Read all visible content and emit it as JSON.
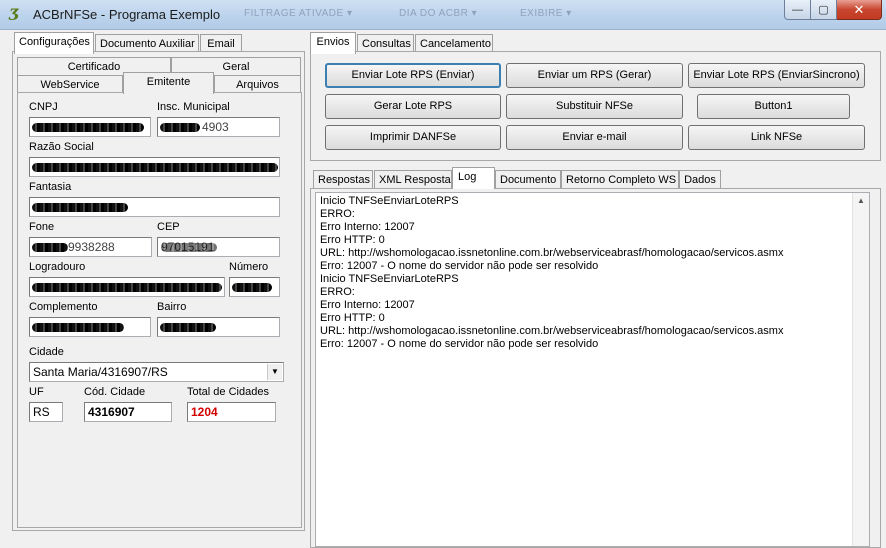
{
  "window": {
    "title": "ACBrNFSe - Programa Exemplo",
    "faded_title_bits": [
      "FILTRAGE ATIVADE ▾",
      "DIA DO ACBR ▾",
      "EXIBIRE ▾"
    ],
    "min_symbol": "—",
    "max_symbol": "▢",
    "close_symbol": "✕"
  },
  "left_tabs": [
    "Configurações",
    "Documento Auxiliar",
    "Email"
  ],
  "config_tabs_row1": [
    "Certificado",
    "Geral"
  ],
  "config_tabs_row2": [
    "WebService",
    "Emitente",
    "Arquivos"
  ],
  "emitente": {
    "cnpj_label": "CNPJ",
    "insc_label": "Insc. Municipal",
    "insc_value_partial": "4903",
    "razao_label": "Razão Social",
    "fantasia_label": "Fantasia",
    "fone_label": "Fone",
    "cep_label": "CEP",
    "fone_value_partial": "9938288",
    "cep_value_partial": "97015191",
    "logradouro_label": "Logradouro",
    "numero_label": "Número",
    "complemento_label": "Complemento",
    "bairro_label": "Bairro",
    "cidade_label": "Cidade",
    "cidade_value": "Santa Maria/4316907/RS",
    "uf_label": "UF",
    "uf_value": "RS",
    "cod_cidade_label": "Cód. Cidade",
    "cod_cidade_value": "4316907",
    "total_cidades_label": "Total de Cidades",
    "total_cidades_value": "1204",
    "total_color": "#d40000"
  },
  "right_tabs": [
    "Envios",
    "Consultas",
    "Cancelamento"
  ],
  "buttons": {
    "enviar_lote": "Enviar Lote RPS (Enviar)",
    "enviar_um": "Enviar um RPS (Gerar)",
    "enviar_sincrono": "Enviar Lote RPS (EnviarSincrono)",
    "gerar_lote": "Gerar Lote RPS",
    "substituir": "Substituir NFSe",
    "button1": "Button1",
    "imprimir": "Imprimir DANFSe",
    "enviar_email": "Enviar e-mail",
    "link": "Link NFSe"
  },
  "result_tabs": [
    "Respostas",
    "XML Resposta",
    "Log",
    "Documento",
    "Retorno Completo WS",
    "Dados"
  ],
  "log": [
    "Inicio TNFSeEnviarLoteRPS",
    "ERRO:",
    "Erro Interno: 12007",
    "Erro HTTP: 0",
    "URL: http://wshomologacao.issnetonline.com.br/webserviceabrasf/homologacao/servicos.asmx",
    "Erro: 12007 - O nome do servidor não pode ser resolvido",
    "Inicio TNFSeEnviarLoteRPS",
    "ERRO:",
    "Erro Interno: 12007",
    "Erro HTTP: 0",
    "URL: http://wshomologacao.issnetonline.com.br/webserviceabrasf/homologacao/servicos.asmx",
    "Erro: 12007 - O nome do servidor não pode ser resolvido"
  ]
}
